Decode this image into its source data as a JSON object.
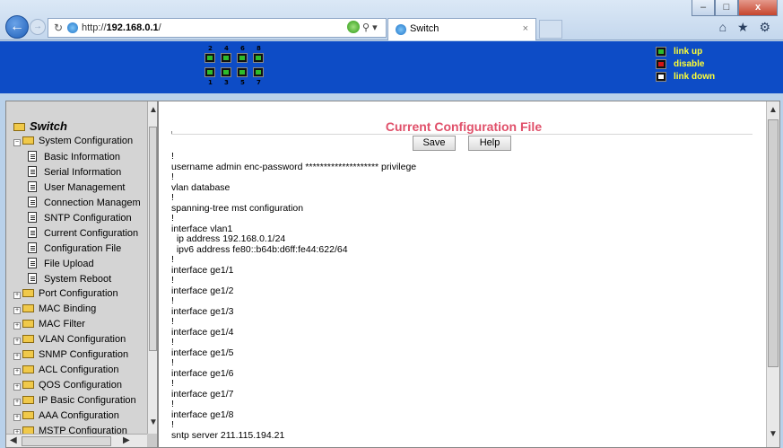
{
  "browser": {
    "url_prefix": "http://",
    "url_host": "192.168.0.1",
    "url_suffix": "/",
    "tab_title": "Switch",
    "tab_close": "×",
    "window_buttons": [
      "–",
      "□",
      "x"
    ],
    "toolbar_icons": "⌂ ★ ⚙"
  },
  "header": {
    "ports_top": [
      "2",
      "4",
      "6",
      "8"
    ],
    "ports_bottom": [
      "1",
      "3",
      "5",
      "7"
    ],
    "legend": [
      {
        "label": "link up",
        "state": "up"
      },
      {
        "label": "disable",
        "state": "disable"
      },
      {
        "label": "link down",
        "state": "down"
      }
    ]
  },
  "sidebar": {
    "root": "Switch",
    "group": "System Configuration",
    "items": [
      "Basic Information",
      "Serial Information",
      "User Management",
      "Connection Managem",
      "SNTP Configuration",
      "Current Configuration",
      "Configuration File",
      "File Upload",
      "System Reboot"
    ],
    "folders": [
      "Port Configuration",
      "MAC Binding",
      "MAC Filter",
      "VLAN Configuration",
      "SNMP Configuration",
      "ACL Configuration",
      "QOS Configuration",
      "IP Basic Configuration",
      "AAA Configuration",
      "MSTP Configuration"
    ]
  },
  "main": {
    "title": "Current Configuration File",
    "save_label": "Save",
    "help_label": "Help",
    "config_text": "!\nusername admin enc-password ******************** privilege\n!\nvlan database\n!\nspanning-tree mst configuration\n!\ninterface vlan1\n  ip address 192.168.0.1/24\n  ipv6 address fe80::b64b:d6ff:fe44:622/64\n!\ninterface ge1/1\n!\ninterface ge1/2\n!\ninterface ge1/3\n!\ninterface ge1/4\n!\ninterface ge1/5\n!\ninterface ge1/6\n!\ninterface ge1/7\n!\ninterface ge1/8\n!\nsntp server 211.115.194.21"
  },
  "colors": {
    "header_bg": "#0d4cc6",
    "title": "#e0506a",
    "legend_text": "#ffff33",
    "link_up": "#2cbc2c",
    "disable": "#d41515",
    "link_down": "#ffffff"
  }
}
